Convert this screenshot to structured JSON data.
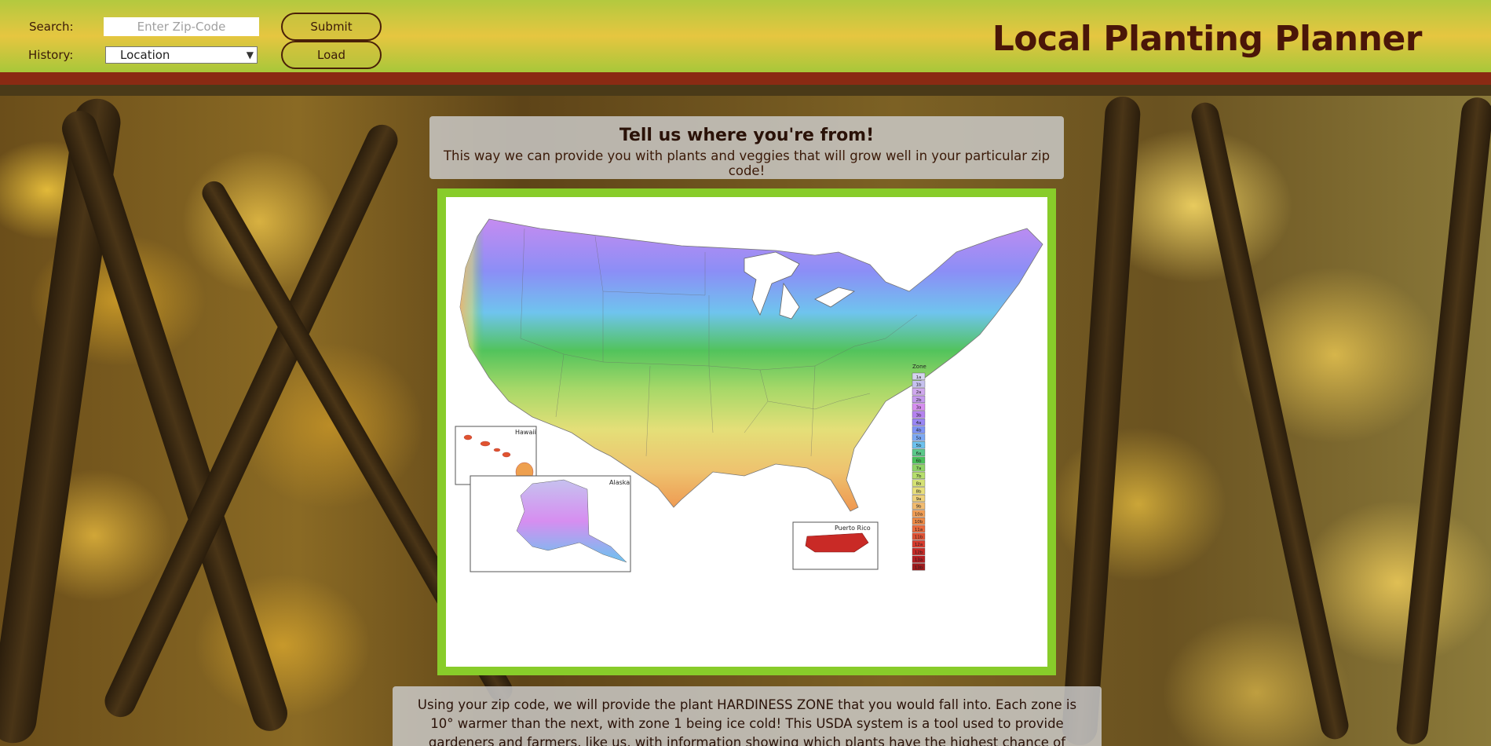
{
  "header": {
    "search_label": "Search:",
    "search_placeholder": "Enter Zip-Code",
    "history_label": "History:",
    "history_selected": "Location",
    "submit_label": "Submit",
    "load_label": "Load",
    "app_title": "Local Planting Planner"
  },
  "intro": {
    "heading": "Tell us where you're from!",
    "subtext": "This way we can provide you with plants and veggies that will grow well in your particular zip code!"
  },
  "map": {
    "legend_title": "Zone",
    "zones": [
      "1a",
      "1b",
      "2a",
      "2b",
      "3a",
      "3b",
      "4a",
      "4b",
      "5a",
      "5b",
      "6a",
      "6b",
      "7a",
      "7b",
      "8a",
      "8b",
      "9a",
      "9b",
      "10a",
      "10b",
      "11a",
      "11b",
      "12a",
      "12b",
      "13a",
      "13b"
    ],
    "zone_colors": [
      "#d5d3f0",
      "#c6c1ef",
      "#d0a8ee",
      "#c59aee",
      "#d68ef0",
      "#b582f0",
      "#9a86f5",
      "#7f94f6",
      "#7ba8f4",
      "#6cc2ef",
      "#5bc98a",
      "#49c05a",
      "#8ed366",
      "#b6df6c",
      "#d5e274",
      "#e8df7a",
      "#efd17a",
      "#f2bb6f",
      "#f29e55",
      "#f08a45",
      "#ec6b3d",
      "#e05234",
      "#d93c2e",
      "#c92a26",
      "#b41e22",
      "#a01c1e"
    ],
    "inset_labels": {
      "hawaii": "Hawaii",
      "alaska": "Alaska",
      "puerto_rico": "Puerto Rico"
    }
  },
  "info": {
    "text": "Using your zip code, we will provide the plant HARDINESS ZONE that you would fall into. Each zone is 10° warmer than the next, with zone 1 being ice cold! This USDA system is a tool used to provide gardeners and farmers, like us, with information showing which plants have the highest chance of success where they are!"
  },
  "colors": {
    "header_border": "#8a2a13",
    "title": "#4a1608",
    "map_border": "#88cc2a"
  }
}
